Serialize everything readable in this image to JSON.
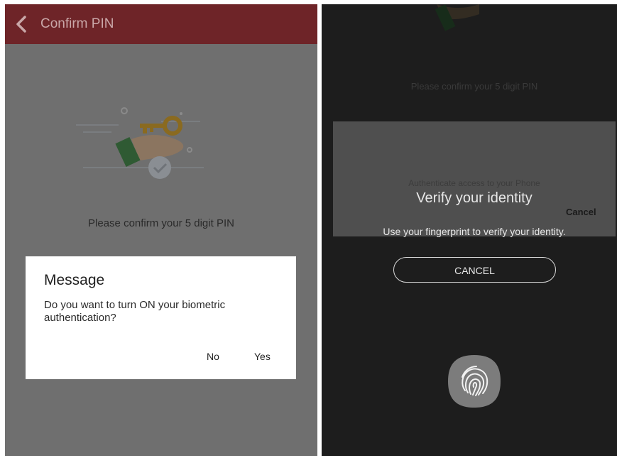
{
  "left_screen": {
    "header": {
      "title": "Confirm PIN",
      "back_icon": "chevron-left-icon"
    },
    "illustration_icon": "key-in-hand-icon",
    "instruction": "Please confirm your 5 digit PIN",
    "dialog": {
      "title": "Message",
      "body": "Do you want to turn ON your biometric authentication?",
      "no_label": "No",
      "yes_label": "Yes"
    }
  },
  "right_screen": {
    "instruction": "Please confirm your 5 digit PIN",
    "sheet": {
      "subtitle": "Authenticate access to your Phone",
      "title": "Verify your identity",
      "cancel_label": "Cancel",
      "message": "Use your fingerprint to verify your identity.",
      "cancel_button_label": "CANCEL",
      "fingerprint_icon": "fingerprint-icon"
    }
  },
  "colors": {
    "header_red": "#6e2428",
    "dim_background": "#6f6f6f",
    "dark_background": "#1d1d1d"
  }
}
